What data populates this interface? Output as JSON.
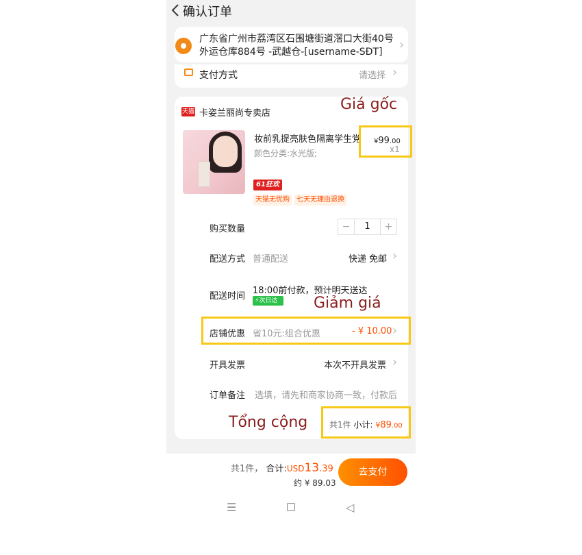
{
  "header": {
    "title": "确认订单"
  },
  "address": {
    "text": "广东省广州市荔湾区石围塘街道滘口大街40号外运仓库884号 -武越仓-[username-SĐT]"
  },
  "payment": {
    "label": "支付方式",
    "value": "请选择"
  },
  "store": {
    "badge": "天猫",
    "name": "卡姿兰丽尚专卖店"
  },
  "product": {
    "title": "妆前乳提亮肤色隔离学生党",
    "variant": "颜色分类:水光版;",
    "price_symbol": "¥",
    "price_int": "99",
    "price_dec": ".00",
    "quantity_mark": "x1",
    "promo_badge": "61狂欢",
    "tags": [
      "天猫无忧购",
      "七天无理由退换"
    ]
  },
  "rows": {
    "quantity": {
      "label": "购买数量",
      "minus": "−",
      "value": "1",
      "plus": "+"
    },
    "delivery_method": {
      "label": "配送方式",
      "sub": "普通配送",
      "value": "快递 免邮"
    },
    "delivery_time": {
      "label": "配送时间",
      "sub": "18:00前付款，预计明天送达",
      "badge": "次日达"
    },
    "store_discount": {
      "label": "店铺优惠",
      "sub": "省10元:组合优惠",
      "value": "- ¥ 10.00"
    },
    "invoice": {
      "label": "开具发票",
      "value": "本次不开具发票"
    },
    "note": {
      "label": "订单备注",
      "placeholder": "选填，请先和商家协商一致，付款后"
    }
  },
  "subtotal": {
    "count": "共1件",
    "label": "小计:",
    "symbol": "¥",
    "int": "89",
    "dec": ".00"
  },
  "footer": {
    "count": "共1件，",
    "total_label": "合计:",
    "currency": "USD",
    "total_int": "13",
    "total_dec": ".39",
    "approx": "约 ¥ 89.03",
    "pay_button": "去支付"
  },
  "annotations": {
    "original_price": "Giá gốc",
    "discount": "Giảm giá",
    "total": "Tổng cộng"
  },
  "colors": {
    "accent": "#ff5000",
    "highlight": "#f7c815",
    "annotation": "#8b1e1e"
  }
}
